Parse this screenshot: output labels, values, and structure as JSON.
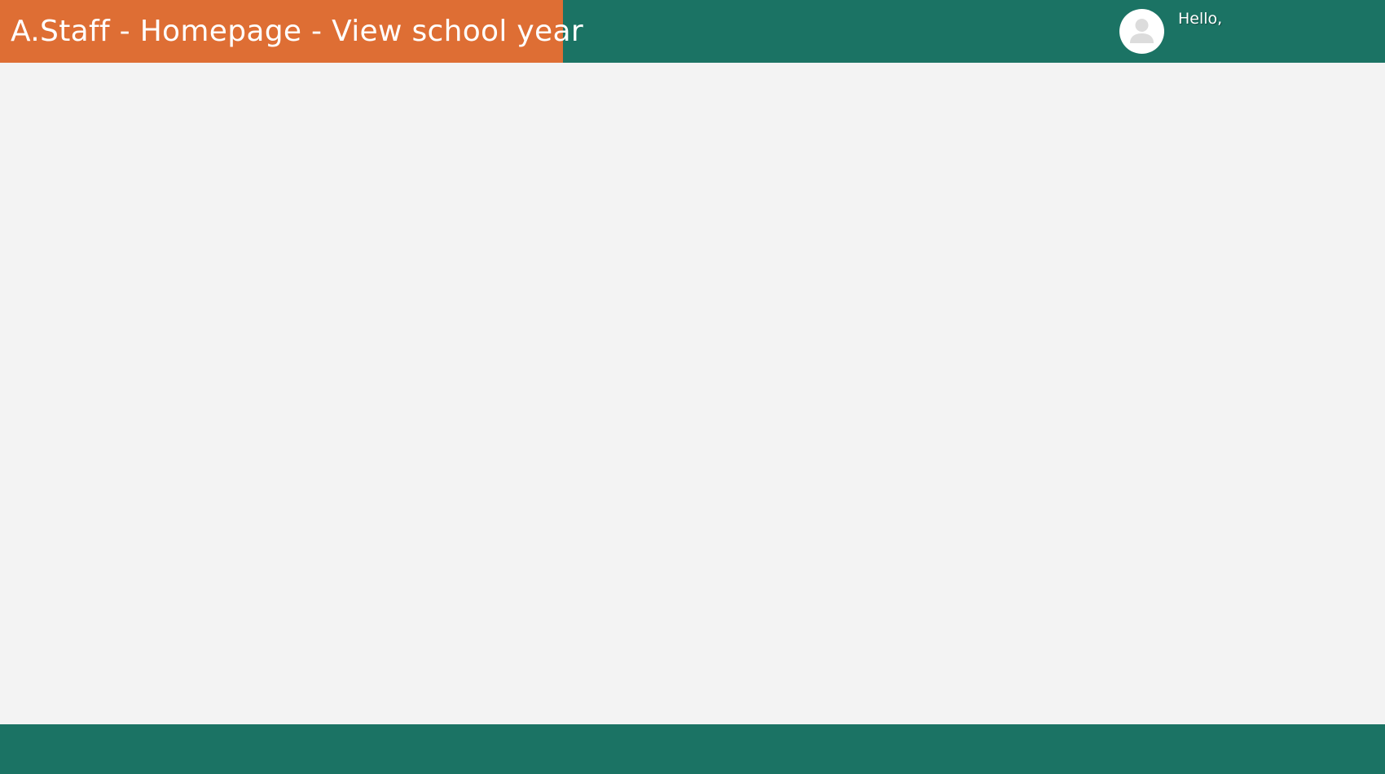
{
  "header": {
    "title": "A.Staff - Homepage - View school year",
    "user": {
      "avatar_icon": "user-avatar-icon",
      "greeting": "Hello,"
    }
  },
  "theme": {
    "header_bg": "#1b7364",
    "title_bg": "#de6e34",
    "content_bg": "#f3f3f3",
    "footer_bg": "#1b7364"
  }
}
